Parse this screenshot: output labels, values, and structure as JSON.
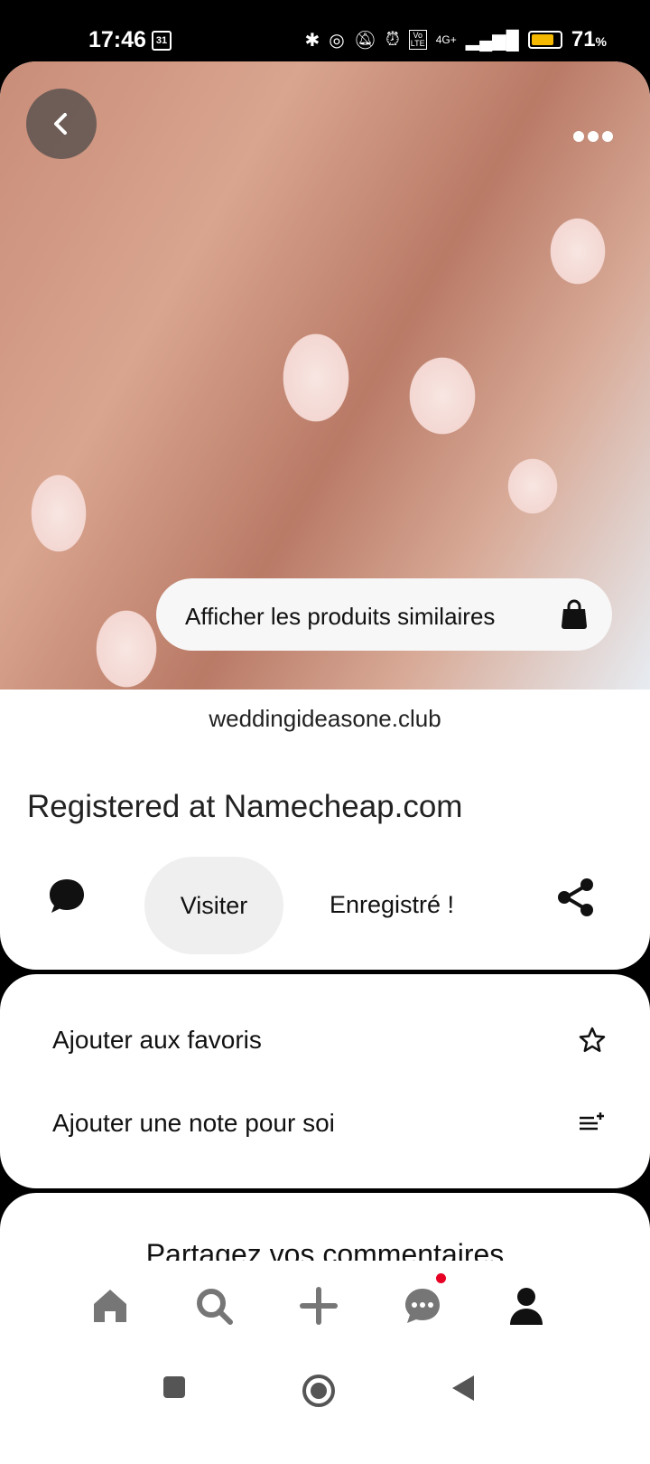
{
  "status_bar": {
    "time": "17:46",
    "calendar_day": "31",
    "battery_percent": "71",
    "battery_unit": "%",
    "network": "4G+",
    "volte": "Vo LTE",
    "battery_color": "#f5b800"
  },
  "pin": {
    "similar_products_label": "Afficher les produits similaires",
    "domain": "weddingideasone.club",
    "title": "Registered at Namecheap.com",
    "visit_label": "Visiter",
    "saved_label": "Enregistré !"
  },
  "menu": {
    "favorites_label": "Ajouter aux favoris",
    "note_label": "Ajouter une note pour soi"
  },
  "comments": {
    "title": "Partagez vos commentaires"
  },
  "bottom_nav": {
    "items": [
      "home-icon",
      "search-icon",
      "add-icon",
      "messages-icon",
      "profile-icon"
    ],
    "notification_color": "#e60023"
  }
}
